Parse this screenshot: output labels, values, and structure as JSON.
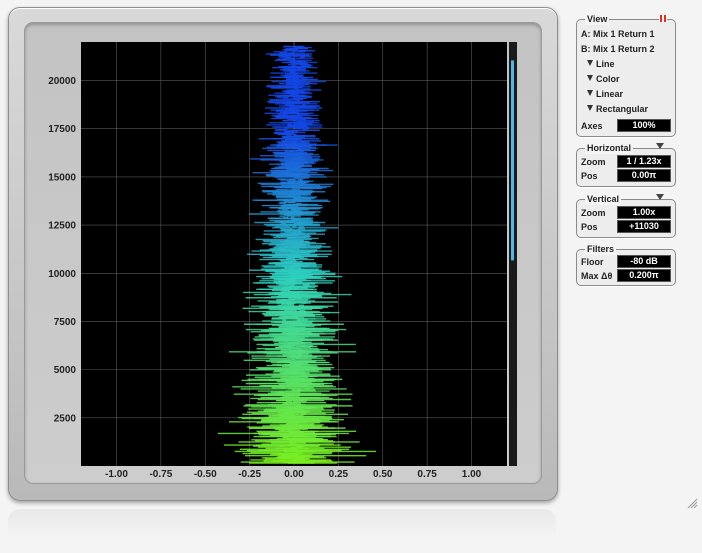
{
  "colors": {
    "plot_bg": "#000000",
    "grid": "#5a5a5a",
    "trace_low": "#7cf01c",
    "trace_mid": "#2ed0c0",
    "trace_high": "#1446e6",
    "accent_pause": "#e03020"
  },
  "plot": {
    "x_ticks": [
      "-1.00",
      "-0.75",
      "-0.50",
      "-0.25",
      "0.00",
      "0.25",
      "0.50",
      "0.75",
      "1.00"
    ],
    "y_ticks": [
      "2500",
      "5000",
      "7500",
      "10000",
      "12500",
      "15000",
      "17500",
      "20000"
    ],
    "x_tick_values": [
      -1.0,
      -0.75,
      -0.5,
      -0.25,
      0.0,
      0.25,
      0.5,
      0.75,
      1.0
    ],
    "y_tick_values": [
      2500,
      5000,
      7500,
      10000,
      12500,
      15000,
      17500,
      20000
    ],
    "x_range": [
      -1.2,
      1.2
    ],
    "y_range": [
      0,
      22000
    ],
    "scroll_position": 0.05
  },
  "view": {
    "title": "View",
    "source_a": "A: Mix 1 Return 1",
    "source_b": "B: Mix 1 Return 2",
    "options": [
      "Line",
      "Color",
      "Linear",
      "Rectangular"
    ],
    "axes_label": "Axes",
    "axes_value": "100%"
  },
  "horizontal": {
    "title": "Horizontal",
    "zoom_label": "Zoom",
    "zoom_value": "1 / 1.23x",
    "pos_label": "Pos",
    "pos_value": "0.00π"
  },
  "vertical": {
    "title": "Vertical",
    "zoom_label": "Zoom",
    "zoom_value": "1.00x",
    "pos_label": "Pos",
    "pos_value": "+11030"
  },
  "filters": {
    "title": "Filters",
    "floor_label": "Floor",
    "floor_value": "-80 dB",
    "maxdt_label": "Max Δθ",
    "maxdt_value": "0.200π"
  }
}
